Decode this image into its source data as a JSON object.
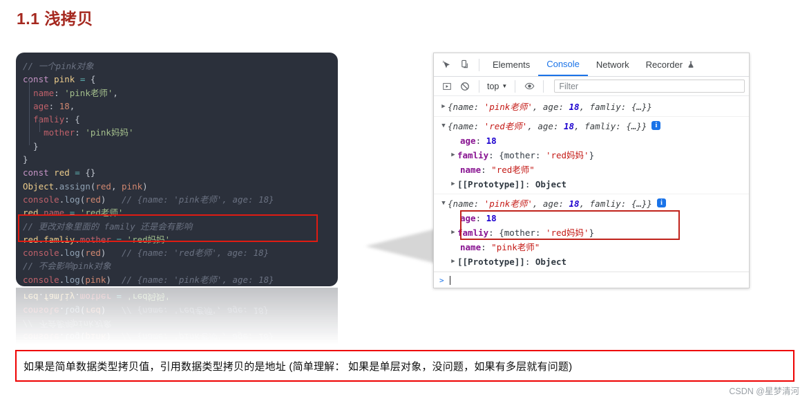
{
  "page": {
    "title": "1.1 浅拷贝",
    "watermark": "CSDN @星梦清河",
    "bottom_note": "如果是简单数据类型拷贝值，引用数据类型拷贝的是地址 (简单理解： 如果是单层对象，没问题，如果有多层就有问题)"
  },
  "code": {
    "lines": [
      [
        {
          "t": "// 一个pink对象",
          "c": "cmt"
        }
      ],
      [
        {
          "t": "const",
          "c": "kw"
        },
        {
          "t": " ",
          "c": "pun"
        },
        {
          "t": "pink",
          "c": "var"
        },
        {
          "t": " ",
          "c": "pun"
        },
        {
          "t": "=",
          "c": "op"
        },
        {
          "t": " {",
          "c": "pun"
        }
      ],
      [
        {
          "t": "  ",
          "c": "pun"
        },
        {
          "t": "name",
          "c": "prop"
        },
        {
          "t": ": ",
          "c": "pun"
        },
        {
          "t": "'pink老师'",
          "c": "str"
        },
        {
          "t": ",",
          "c": "pun"
        }
      ],
      [
        {
          "t": "  ",
          "c": "pun"
        },
        {
          "t": "age",
          "c": "prop"
        },
        {
          "t": ": ",
          "c": "pun"
        },
        {
          "t": "18",
          "c": "num"
        },
        {
          "t": ",",
          "c": "pun"
        }
      ],
      [
        {
          "t": "  ",
          "c": "pun"
        },
        {
          "t": "famliy",
          "c": "prop"
        },
        {
          "t": ": {",
          "c": "pun"
        }
      ],
      [
        {
          "t": "    ",
          "c": "pun"
        },
        {
          "t": "mother",
          "c": "prop"
        },
        {
          "t": ": ",
          "c": "pun"
        },
        {
          "t": "'pink妈妈'",
          "c": "str"
        }
      ],
      [
        {
          "t": "  }",
          "c": "pun"
        }
      ],
      [
        {
          "t": "}",
          "c": "pun"
        }
      ],
      [
        {
          "t": "const",
          "c": "kw"
        },
        {
          "t": " ",
          "c": "pun"
        },
        {
          "t": "red",
          "c": "var"
        },
        {
          "t": " ",
          "c": "pun"
        },
        {
          "t": "=",
          "c": "op"
        },
        {
          "t": " {}",
          "c": "pun"
        }
      ],
      [
        {
          "t": "Object",
          "c": "obj"
        },
        {
          "t": ".",
          "c": "pun"
        },
        {
          "t": "assign",
          "c": "fn"
        },
        {
          "t": "(",
          "c": "pun"
        },
        {
          "t": "red",
          "c": "par"
        },
        {
          "t": ", ",
          "c": "pun"
        },
        {
          "t": "pink",
          "c": "par"
        },
        {
          "t": ")",
          "c": "pun"
        }
      ],
      [
        {
          "t": "console",
          "c": "prop"
        },
        {
          "t": ".",
          "c": "pun"
        },
        {
          "t": "log",
          "c": "fn"
        },
        {
          "t": "(",
          "c": "pun"
        },
        {
          "t": "red",
          "c": "par"
        },
        {
          "t": ")",
          "c": "pun"
        },
        {
          "t": "   ",
          "c": "pun"
        },
        {
          "t": "// {name: 'pink老师', age: 18}",
          "c": "cmt"
        }
      ],
      [
        {
          "t": "red",
          "c": "var"
        },
        {
          "t": ".",
          "c": "pun"
        },
        {
          "t": "name",
          "c": "prop"
        },
        {
          "t": " ",
          "c": "pun"
        },
        {
          "t": "=",
          "c": "op"
        },
        {
          "t": " ",
          "c": "pun"
        },
        {
          "t": "'red老师'",
          "c": "str"
        }
      ],
      [
        {
          "t": "// 更改对象里面的 family 还是会有影响",
          "c": "cmt"
        }
      ],
      [
        {
          "t": "red",
          "c": "var"
        },
        {
          "t": ".",
          "c": "pun"
        },
        {
          "t": "famliy",
          "c": "var"
        },
        {
          "t": ".",
          "c": "pun"
        },
        {
          "t": "mother",
          "c": "prop"
        },
        {
          "t": " ",
          "c": "pun"
        },
        {
          "t": "=",
          "c": "op"
        },
        {
          "t": " ",
          "c": "pun"
        },
        {
          "t": "'red妈妈'",
          "c": "str"
        }
      ],
      [
        {
          "t": "console",
          "c": "prop"
        },
        {
          "t": ".",
          "c": "pun"
        },
        {
          "t": "log",
          "c": "fn"
        },
        {
          "t": "(",
          "c": "pun"
        },
        {
          "t": "red",
          "c": "par"
        },
        {
          "t": ")",
          "c": "pun"
        },
        {
          "t": "   ",
          "c": "pun"
        },
        {
          "t": "// {name: 'red老师', age: 18}",
          "c": "cmt"
        }
      ],
      [
        {
          "t": "// 不会影响pink对象",
          "c": "cmt"
        }
      ],
      [
        {
          "t": "console",
          "c": "prop"
        },
        {
          "t": ".",
          "c": "pun"
        },
        {
          "t": "log",
          "c": "fn"
        },
        {
          "t": "(",
          "c": "pun"
        },
        {
          "t": "pink",
          "c": "par"
        },
        {
          "t": ")",
          "c": "pun"
        },
        {
          "t": "  ",
          "c": "pun"
        },
        {
          "t": "// {name: 'pink老师', age: 18}",
          "c": "cmt"
        }
      ]
    ],
    "reflection_lines": [
      [
        {
          "t": "console",
          "c": "prop"
        },
        {
          "t": ".",
          "c": "pun"
        },
        {
          "t": "log",
          "c": "fn"
        },
        {
          "t": "(",
          "c": "pun"
        },
        {
          "t": "pink",
          "c": "par"
        },
        {
          "t": ")",
          "c": "pun"
        },
        {
          "t": "  ",
          "c": "pun"
        },
        {
          "t": "// {name: 'pink老师', age: 18}",
          "c": "cmt"
        }
      ],
      [
        {
          "t": "// 不会影响pink对象",
          "c": "cmt"
        }
      ],
      [
        {
          "t": "console",
          "c": "prop"
        },
        {
          "t": ".",
          "c": "pun"
        },
        {
          "t": "log",
          "c": "fn"
        },
        {
          "t": "(",
          "c": "pun"
        },
        {
          "t": "red",
          "c": "par"
        },
        {
          "t": ")",
          "c": "pun"
        },
        {
          "t": "   ",
          "c": "pun"
        },
        {
          "t": "// {name: 'red老师', age: 18}",
          "c": "cmt"
        }
      ],
      [
        {
          "t": "red",
          "c": "var"
        },
        {
          "t": ".",
          "c": "pun"
        },
        {
          "t": "famliy",
          "c": "var"
        },
        {
          "t": ".",
          "c": "pun"
        },
        {
          "t": "mother",
          "c": "prop"
        },
        {
          "t": " ",
          "c": "pun"
        },
        {
          "t": "=",
          "c": "op"
        },
        {
          "t": " ",
          "c": "pun"
        },
        {
          "t": "'red妈妈'",
          "c": "str"
        }
      ]
    ]
  },
  "devtools": {
    "icons": {
      "inspect": "inspect-element-icon",
      "device": "device-toolbar-icon",
      "execute": "execute-icon",
      "clear": "clear-console-icon",
      "eye": "live-expression-icon",
      "flask": "experiments-flask-icon"
    },
    "tabs": [
      {
        "label": "Elements",
        "active": false
      },
      {
        "label": "Console",
        "active": true
      },
      {
        "label": "Network",
        "active": false
      },
      {
        "label": "Recorder",
        "active": false,
        "icon": "flask"
      }
    ],
    "context": "top",
    "filter_placeholder": "Filter",
    "filter_value": "",
    "prompt_symbol": ">"
  },
  "console_log": [
    {
      "id": "log-pink-first",
      "collapsed": true,
      "triangle": "▶",
      "preview": [
        {
          "t": "{name: ",
          "c": "p-key"
        },
        {
          "t": "'pink老师'",
          "c": "s-str"
        },
        {
          "t": ", age: ",
          "c": "p-key"
        },
        {
          "t": "18",
          "c": "s-num"
        },
        {
          "t": ", famliy: {…}}",
          "c": "p-key"
        }
      ],
      "badge": false,
      "props": []
    },
    {
      "id": "log-red-expanded",
      "collapsed": false,
      "triangle": "▼",
      "preview": [
        {
          "t": "{name: ",
          "c": "p-key"
        },
        {
          "t": "'red老师'",
          "c": "s-str"
        },
        {
          "t": ", age: ",
          "c": "p-key"
        },
        {
          "t": "18",
          "c": "s-num"
        },
        {
          "t": ", famliy: {…}}",
          "c": "p-key"
        }
      ],
      "badge": true,
      "badge_label": "i",
      "props": [
        {
          "tri": "",
          "parts": [
            {
              "t": "age",
              "c": "pname"
            },
            {
              "t": ": ",
              "c": "pplain"
            },
            {
              "t": "18",
              "c": "pnum"
            }
          ]
        },
        {
          "tri": "▶",
          "parts": [
            {
              "t": "famliy",
              "c": "pname"
            },
            {
              "t": ": {mother: ",
              "c": "pplain"
            },
            {
              "t": "'red妈妈'",
              "c": "pstr"
            },
            {
              "t": "}",
              "c": "pplain"
            }
          ]
        },
        {
          "tri": "",
          "parts": [
            {
              "t": "name",
              "c": "pname"
            },
            {
              "t": ": ",
              "c": "pplain"
            },
            {
              "t": "\"red老师\"",
              "c": "pstr"
            }
          ]
        },
        {
          "tri": "▶",
          "parts": [
            {
              "t": "[[Prototype]]",
              "c": "proto"
            },
            {
              "t": ": ",
              "c": "pplain"
            },
            {
              "t": "Object",
              "c": "proto"
            }
          ]
        }
      ]
    },
    {
      "id": "log-pink-expanded",
      "collapsed": false,
      "triangle": "▼",
      "preview": [
        {
          "t": "{name: ",
          "c": "p-key"
        },
        {
          "t": "'pink老师'",
          "c": "s-str"
        },
        {
          "t": ", age: ",
          "c": "p-key"
        },
        {
          "t": "18",
          "c": "s-num"
        },
        {
          "t": ", famliy: {…}}",
          "c": "p-key"
        }
      ],
      "badge": true,
      "badge_label": "i",
      "props": [
        {
          "tri": "",
          "parts": [
            {
              "t": "age",
              "c": "pname"
            },
            {
              "t": ": ",
              "c": "pplain"
            },
            {
              "t": "18",
              "c": "pnum"
            }
          ]
        },
        {
          "tri": "▶",
          "parts": [
            {
              "t": "famliy",
              "c": "pname"
            },
            {
              "t": ": {mother: ",
              "c": "pplain"
            },
            {
              "t": "'red妈妈'",
              "c": "pstr"
            },
            {
              "t": "}",
              "c": "pplain"
            }
          ]
        },
        {
          "tri": "",
          "parts": [
            {
              "t": "name",
              "c": "pname"
            },
            {
              "t": ": ",
              "c": "pplain"
            },
            {
              "t": "\"pink老师\"",
              "c": "pstr"
            }
          ]
        },
        {
          "tri": "▶",
          "parts": [
            {
              "t": "[[Prototype]]",
              "c": "proto"
            },
            {
              "t": ": ",
              "c": "pplain"
            },
            {
              "t": "Object",
              "c": "proto"
            }
          ]
        }
      ]
    }
  ],
  "annotations": {
    "code_highlight_name": "code-red-highlight-box",
    "console_highlight_name": "console-red-highlight-box"
  },
  "colors": {
    "title": "#a5281f",
    "code_bg": "#2b303b",
    "highlight_red": "#e01b12",
    "note_border": "#ee0000",
    "devtools_accent": "#1a73e8"
  }
}
